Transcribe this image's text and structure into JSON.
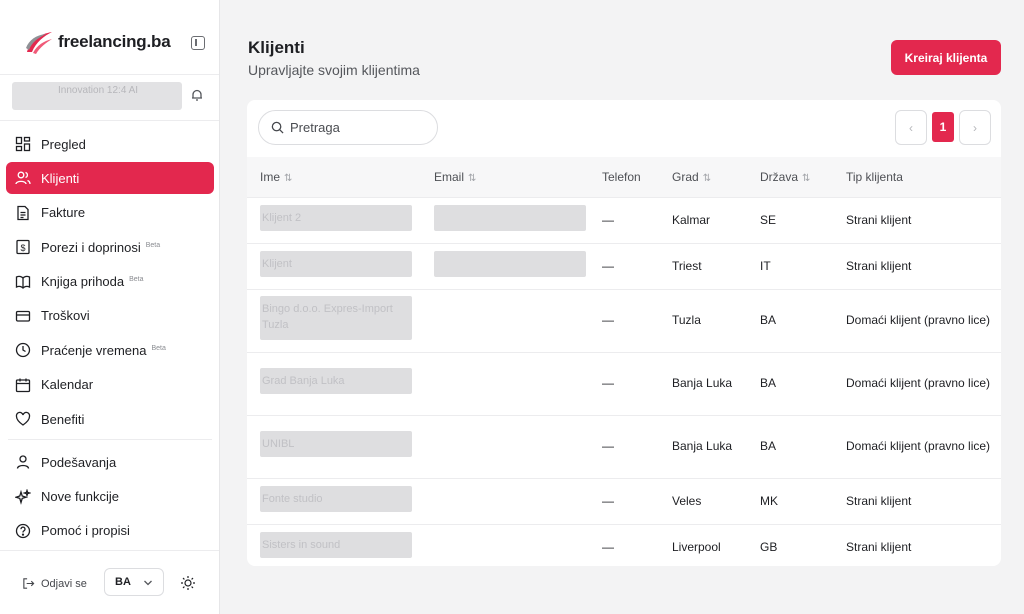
{
  "brand": {
    "name": "freelancing.ba",
    "accent": "#e3284e"
  },
  "account": {
    "name": "Innovation 12:4 AI"
  },
  "nav": {
    "items": [
      {
        "label": "Pregled",
        "icon": "dashboard-icon",
        "beta": ""
      },
      {
        "label": "Klijenti",
        "icon": "users-icon",
        "beta": "",
        "active": true
      },
      {
        "label": "Fakture",
        "icon": "invoice-icon",
        "beta": ""
      },
      {
        "label": "Porezi i doprinosi",
        "icon": "tax-icon",
        "beta": "Beta"
      },
      {
        "label": "Knjiga prihoda",
        "icon": "book-icon",
        "beta": "Beta"
      },
      {
        "label": "Troškovi",
        "icon": "card-icon",
        "beta": ""
      },
      {
        "label": "Praćenje vremena",
        "icon": "clock-icon",
        "beta": "Beta"
      },
      {
        "label": "Kalendar",
        "icon": "calendar-icon",
        "beta": ""
      },
      {
        "label": "Benefiti",
        "icon": "heart-icon",
        "beta": ""
      }
    ],
    "secondary": [
      {
        "label": "Podešavanja",
        "icon": "user-icon"
      },
      {
        "label": "Nove funkcije",
        "icon": "sparkles-icon"
      },
      {
        "label": "Pomoć i propisi",
        "icon": "help-icon"
      }
    ]
  },
  "footer": {
    "logout_label": "Odjavi se",
    "language": "BA"
  },
  "page": {
    "title": "Klijenti",
    "subtitle": "Upravljajte svojim klijentima",
    "create_label": "Kreiraj klijenta"
  },
  "search": {
    "placeholder": "Pretraga"
  },
  "pagination": {
    "current": "1",
    "prev": "‹",
    "next": "›"
  },
  "table": {
    "columns": {
      "name": "Ime",
      "email": "Email",
      "phone": "Telefon",
      "city": "Grad",
      "country": "Država",
      "type": "Tip klijenta"
    },
    "rows": [
      {
        "name": "Klijent 2",
        "email": "",
        "phone": "—",
        "city": "Kalmar",
        "country": "SE",
        "type": "Strani klijent"
      },
      {
        "name": "Klijent",
        "email": "",
        "phone": "—",
        "city": "Triest",
        "country": "IT",
        "type": "Strani klijent"
      },
      {
        "name": "Bingo d.o.o. Expres-Import Tuzla",
        "email": "",
        "phone": "—",
        "city": "Tuzla",
        "country": "BA",
        "type": "Domaći klijent (pravno lice)"
      },
      {
        "name": "Grad Banja Luka",
        "email": "",
        "phone": "—",
        "city": "Banja Luka",
        "country": "BA",
        "type": "Domaći klijent (pravno lice)"
      },
      {
        "name": "UNIBL",
        "email": "",
        "phone": "—",
        "city": "Banja Luka",
        "country": "BA",
        "type": "Domaći klijent (pravno lice)"
      },
      {
        "name": "Fonte studio",
        "email": "",
        "phone": "—",
        "city": "Veles",
        "country": "MK",
        "type": "Strani klijent"
      },
      {
        "name": "Sisters in sound",
        "email": "",
        "phone": "—",
        "city": "Liverpool",
        "country": "GB",
        "type": "Strani klijent"
      }
    ]
  }
}
